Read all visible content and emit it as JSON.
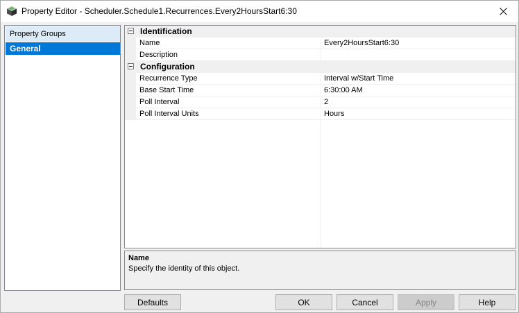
{
  "window": {
    "title": "Property Editor - Scheduler.Schedule1.Recurrences.Every2HoursStart6:30",
    "app_icon": "gem-cube-icon",
    "close_icon": "close-icon"
  },
  "left_panel": {
    "header": "Property Groups",
    "items": [
      {
        "label": "General",
        "selected": true
      }
    ]
  },
  "property_grid": {
    "categories": [
      {
        "label": "Identification",
        "expanded": true,
        "properties": [
          {
            "name": "Name",
            "value": "Every2HoursStart6:30"
          },
          {
            "name": "Description",
            "value": ""
          }
        ]
      },
      {
        "label": "Configuration",
        "expanded": true,
        "properties": [
          {
            "name": "Recurrence Type",
            "value": "Interval w/Start Time"
          },
          {
            "name": "Base Start Time",
            "value": "6:30:00 AM"
          },
          {
            "name": "Poll Interval",
            "value": "2"
          },
          {
            "name": "Poll Interval Units",
            "value": "Hours"
          }
        ]
      }
    ]
  },
  "help_panel": {
    "title": "Name",
    "description": "Specify the identity of this object."
  },
  "buttons": {
    "defaults": "Defaults",
    "ok": "OK",
    "cancel": "Cancel",
    "apply": "Apply",
    "help": "Help"
  },
  "colors": {
    "selection": "#0078d7",
    "header_bg": "#dcebf7",
    "category_bg": "#f0f0f0"
  }
}
